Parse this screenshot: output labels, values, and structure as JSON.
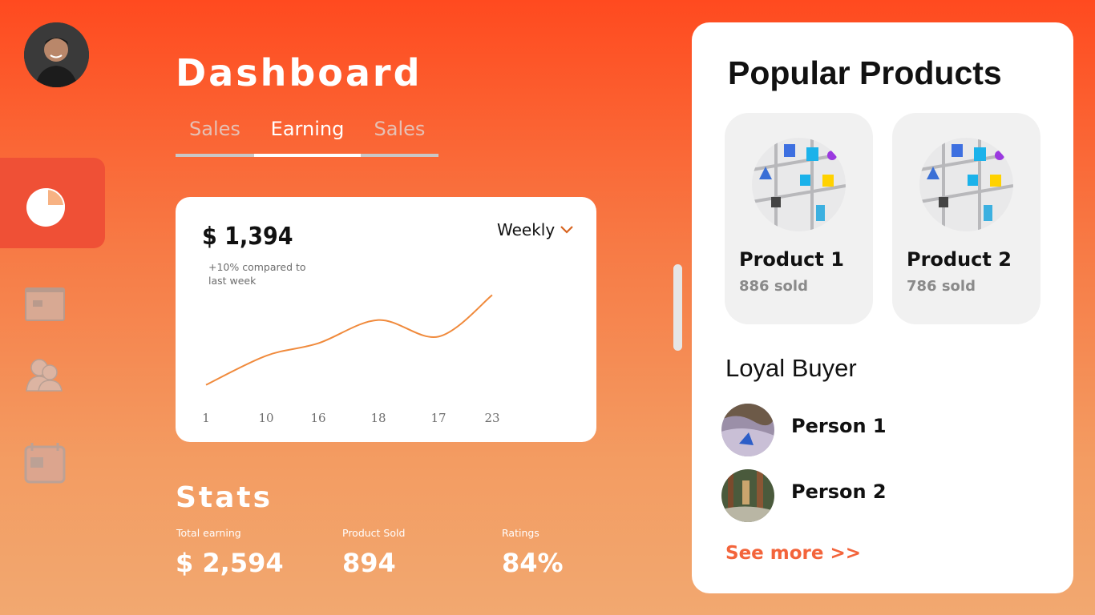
{
  "page": {
    "title": "Dashboard"
  },
  "sidebar": {
    "items": [
      {
        "icon": "pie-chart-icon",
        "active": true
      },
      {
        "icon": "window-icon",
        "active": false
      },
      {
        "icon": "users-icon",
        "active": false
      },
      {
        "icon": "calendar-icon",
        "active": false
      }
    ]
  },
  "tabs": [
    {
      "label": "Sales",
      "active": false
    },
    {
      "label": "Earning",
      "active": true
    },
    {
      "label": "Sales",
      "active": false
    }
  ],
  "earning_card": {
    "amount": "$ 1,394",
    "comparison": "+10% compared to last week",
    "period": "Weekly"
  },
  "chart_data": {
    "type": "line",
    "x": [
      "1",
      "10",
      "16",
      "18",
      "17",
      "23"
    ],
    "series": [
      {
        "values": [
          10,
          45,
          60,
          88,
          68,
          118
        ]
      }
    ],
    "ylim": [
      0,
      130
    ],
    "grid": false,
    "color": "#f08a3c"
  },
  "stats": {
    "title": "Stats",
    "items": [
      {
        "label": "Total earning",
        "value": "$ 2,594"
      },
      {
        "label": "Product Sold",
        "value": "894"
      },
      {
        "label": "Ratings",
        "value": "84%"
      }
    ]
  },
  "popular": {
    "title": "Popular Products",
    "products": [
      {
        "name": "Product 1",
        "sold": "886 sold"
      },
      {
        "name": "Product 2",
        "sold": "786 sold"
      }
    ]
  },
  "loyal": {
    "title": "Loyal Buyer",
    "buyers": [
      {
        "name": "Person 1"
      },
      {
        "name": "Person 2"
      }
    ],
    "see_more": "See more >>"
  },
  "colors": {
    "accent": "#ff4a1f",
    "link": "#f3643b",
    "line": "#f08a3c"
  }
}
